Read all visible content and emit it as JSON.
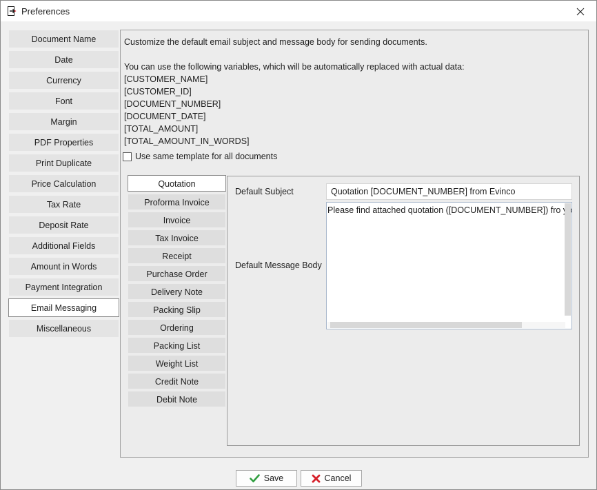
{
  "window": {
    "title": "Preferences"
  },
  "nav": {
    "items": [
      "Document Name",
      "Date",
      "Currency",
      "Font",
      "Margin",
      "PDF Properties",
      "Print Duplicate",
      "Price Calculation",
      "Tax Rate",
      "Deposit Rate",
      "Additional Fields",
      "Amount in Words",
      "Payment Integration",
      "Email Messaging",
      "Miscellaneous"
    ],
    "selected": "Email Messaging"
  },
  "main": {
    "intro": "Customize the default email subject and message body for sending documents.",
    "variables_intro": "You can use the following variables, which will be automatically replaced with actual data:",
    "variables": [
      "[CUSTOMER_NAME]",
      "[CUSTOMER_ID]",
      "[DOCUMENT_NUMBER]",
      "[DOCUMENT_DATE]",
      "[TOTAL_AMOUNT]",
      "[TOTAL_AMOUNT_IN_WORDS]"
    ],
    "same_template_label": "Use same template for all documents",
    "same_template_checked": false
  },
  "doc_tabs": {
    "items": [
      "Quotation",
      "Proforma Invoice",
      "Invoice",
      "Tax Invoice",
      "Receipt",
      "Purchase Order",
      "Delivery Note",
      "Packing Slip",
      "Ordering",
      "Packing List",
      "Weight List",
      "Credit Note",
      "Debit Note"
    ],
    "selected": "Quotation"
  },
  "editor": {
    "subject_label": "Default Subject",
    "subject_value": "Quotation [DOCUMENT_NUMBER] from Evinco",
    "body_label": "Default Message Body",
    "body_value": "Please find attached quotation ([DOCUMENT_NUMBER]) fro yo"
  },
  "buttons": {
    "save": "Save",
    "cancel": "Cancel"
  },
  "colors": {
    "save_icon": "#2e9d3e",
    "cancel_icon": "#d6202a"
  }
}
